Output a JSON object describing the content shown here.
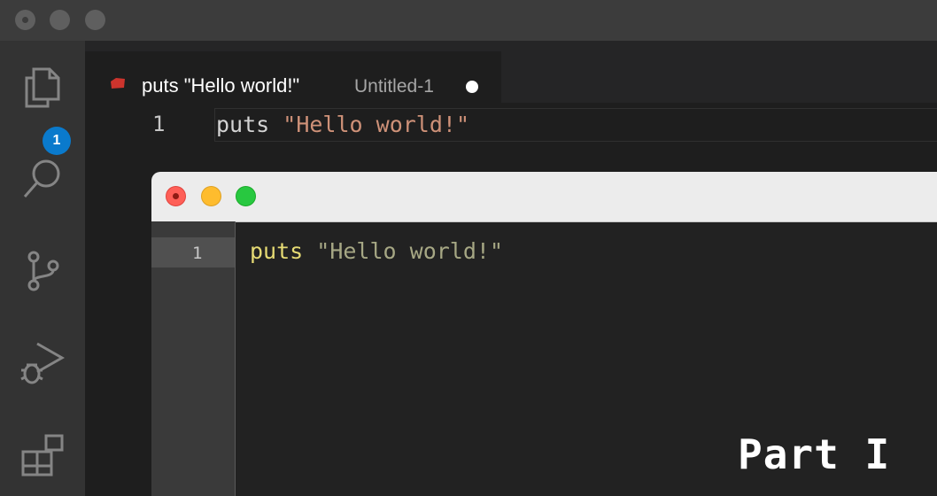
{
  "outer_window": {
    "tab": {
      "filename": "puts \"Hello world!\"",
      "label": "Untitled-1"
    },
    "activity_bar": {
      "items": [
        {
          "icon": "files-icon"
        },
        {
          "icon": "search-icon"
        },
        {
          "icon": "source-control-icon"
        },
        {
          "icon": "run-debug-icon"
        },
        {
          "icon": "extensions-icon"
        }
      ],
      "badge_count": "1"
    },
    "editor": {
      "line_number": "1",
      "code_keyword": "puts",
      "code_string": "\"Hello world!\""
    }
  },
  "inner_window": {
    "line_number": "1",
    "code_keyword": "puts",
    "code_string": "\"Hello world!\""
  },
  "watermark": "Part I",
  "colors": {
    "accent_badge": "#0a7acc",
    "ruby_icon": "#cc342d",
    "string_outer": "#ce9178",
    "keyword_inner": "#e6db74",
    "string_inner": "#a6a784"
  }
}
